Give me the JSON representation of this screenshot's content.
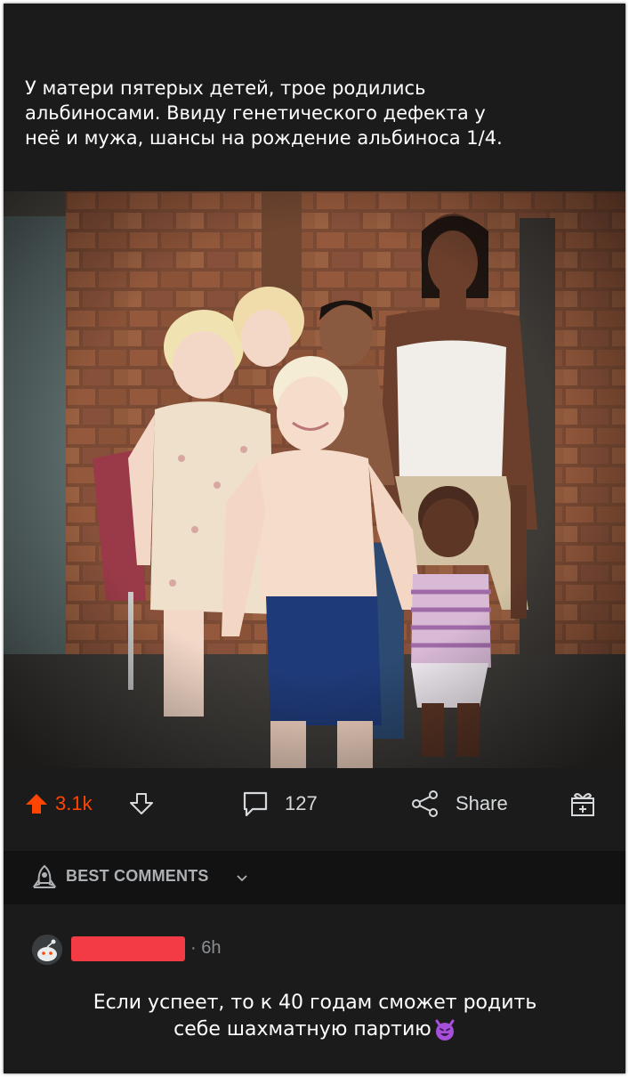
{
  "post": {
    "caption_lines": [
      "У матери пятерых детей, трое родились",
      "альбиносами. Ввиду генетического дефекта у",
      "неё и мужа, шансы на рождение альбиноса 1/4."
    ]
  },
  "actions": {
    "upvotes": "3.1k",
    "comments": "127",
    "share": "Share"
  },
  "sort": {
    "label": "BEST COMMENTS"
  },
  "comment": {
    "time": "· 6h",
    "lines": [
      "Если успеет, то к 40 годам сможет родить",
      "себе шахматную партию"
    ],
    "emoji": "smiling-devil"
  },
  "colors": {
    "background": "#1b1b1c",
    "upvote": "#ff4500",
    "text": "#d7dadc",
    "redaction": "#f23b45",
    "emoji": "#a64fd8"
  }
}
